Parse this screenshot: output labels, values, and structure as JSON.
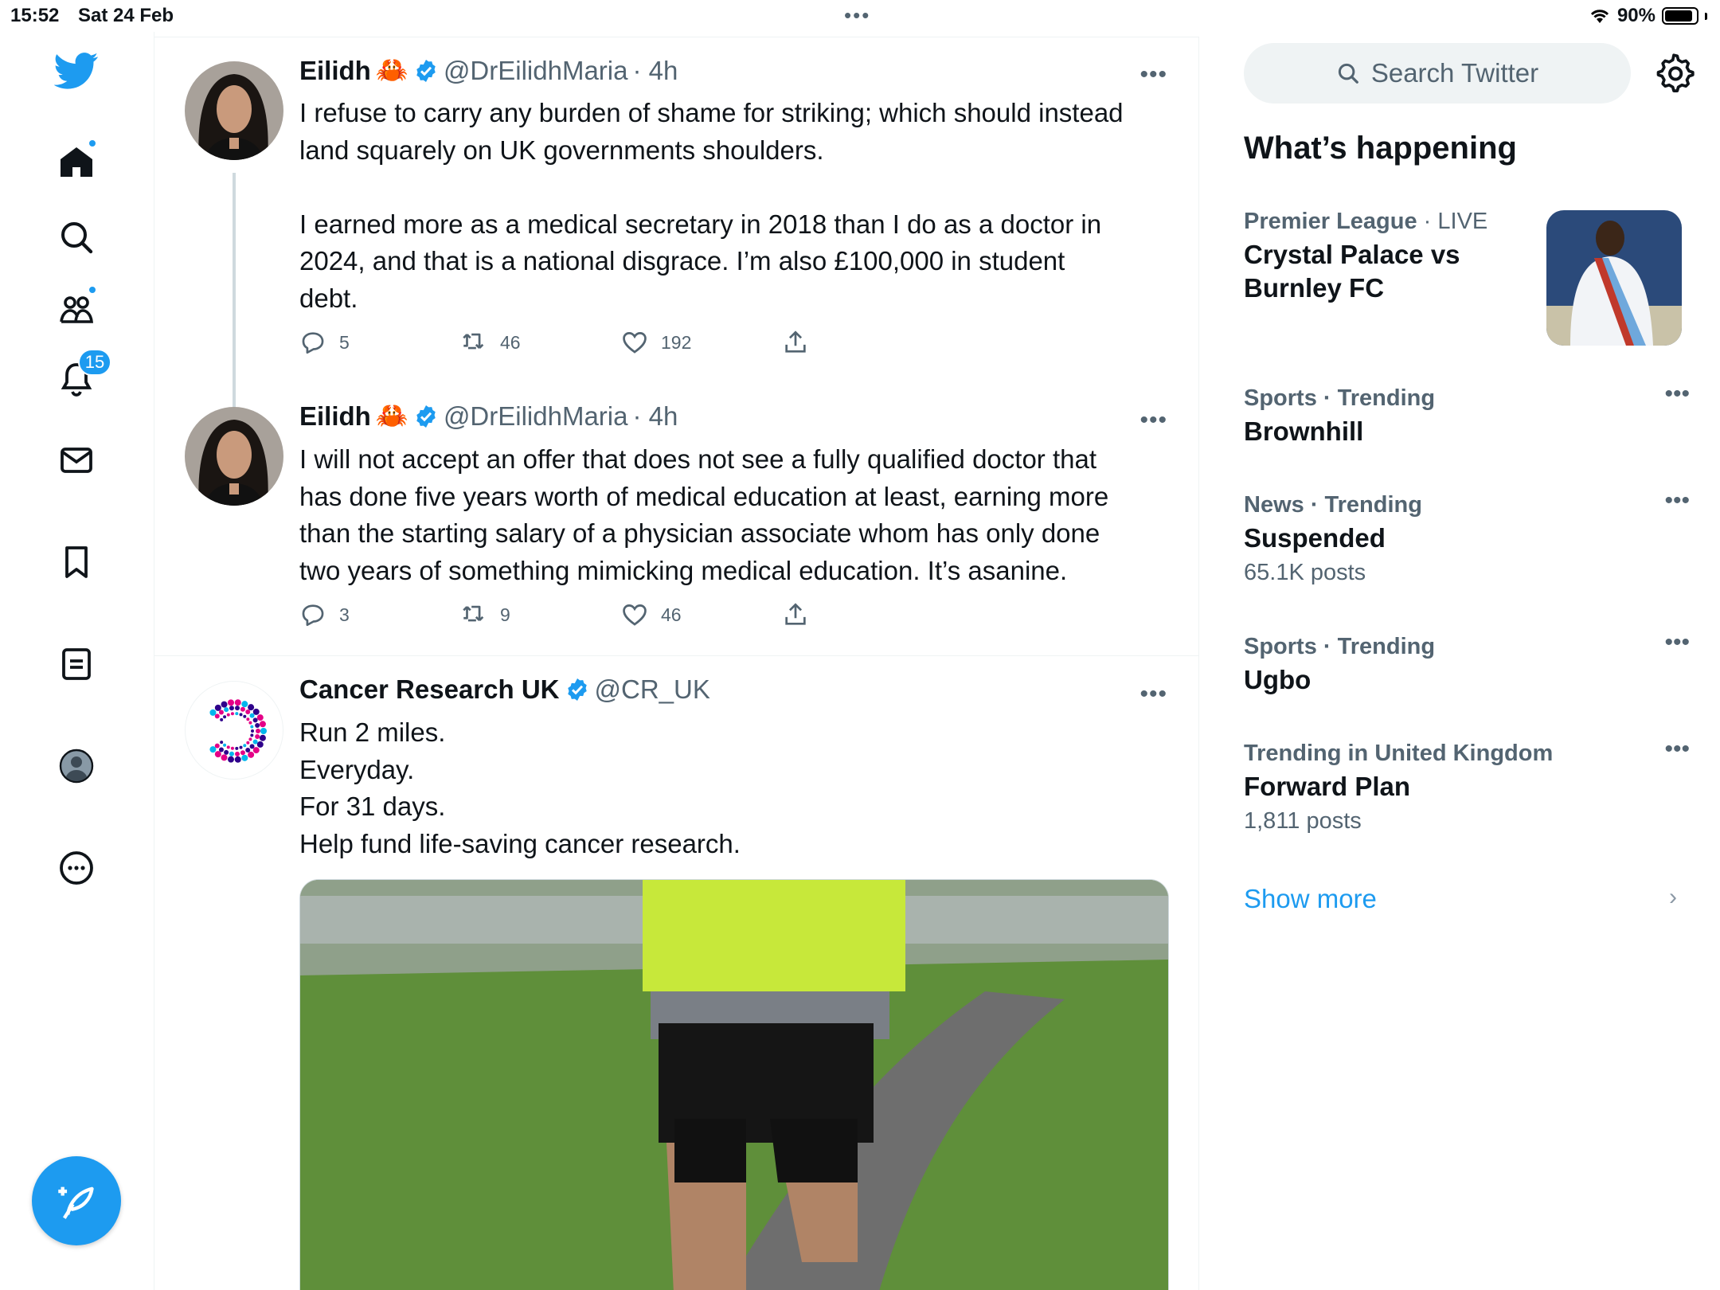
{
  "status_bar": {
    "time": "15:52",
    "date": "Sat 24 Feb",
    "dots": "•••",
    "battery": "90%",
    "battery_level": 0.9
  },
  "nav": {
    "notifications_badge": "15"
  },
  "tweets": [
    {
      "name": "Eilidh",
      "emoji": "🦀",
      "handle": "@DrEilidhMaria",
      "sep_time": "· 4h",
      "more": "•••",
      "text": "I refuse to carry any burden of shame for striking; which should instead\nland squarely on UK governments shoulders.\n\nI earned more as a medical secretary in 2018 than I do as a doctor in\n2024, and that is a national disgrace. I’m also £100,000 in student\ndebt.",
      "replies": "5",
      "retweets": "46",
      "likes": "192"
    },
    {
      "name": "Eilidh",
      "emoji": "🦀",
      "handle": "@DrEilidhMaria",
      "sep_time": "· 4h",
      "more": "•••",
      "text": "I will not accept an offer that does not see a fully qualified doctor that\nhas done five years worth of medical education at least, earning more\nthan the starting salary of a physician associate whom has only done\ntwo years of something mimicking medical education. It’s asanine.",
      "replies": "3",
      "retweets": "9",
      "likes": "46"
    },
    {
      "name": "Cancer Research UK",
      "handle": "@CR_UK",
      "more": "•••",
      "text": "Run 2 miles.\nEveryday.\nFor 31 days.\nHelp fund life-saving cancer research."
    }
  ],
  "sidebar": {
    "search_placeholder": "Search Twitter",
    "whats_happening": "What’s happening",
    "trends": [
      {
        "category": "Premier League",
        "suffix": "· LIVE",
        "name": "Crystal Palace vs\nBurnley FC",
        "count": ""
      },
      {
        "category": "Sports · Trending",
        "suffix": "",
        "name": "Brownhill",
        "count": ""
      },
      {
        "category": "News · Trending",
        "suffix": "",
        "name": "Suspended",
        "count": "65.1K posts"
      },
      {
        "category": "Sports · Trending",
        "suffix": "",
        "name": "Ugbo",
        "count": ""
      },
      {
        "category": "Trending in United Kingdom",
        "suffix": "",
        "name": "Forward Plan",
        "count": "1,811 posts"
      }
    ],
    "trend_more": "•••",
    "show_more": "Show more",
    "show_more_chevron": "›"
  },
  "colors": {
    "accent": "#1d9bf0",
    "text": "#0f1419",
    "muted": "#536471",
    "border": "#eff3f4"
  }
}
